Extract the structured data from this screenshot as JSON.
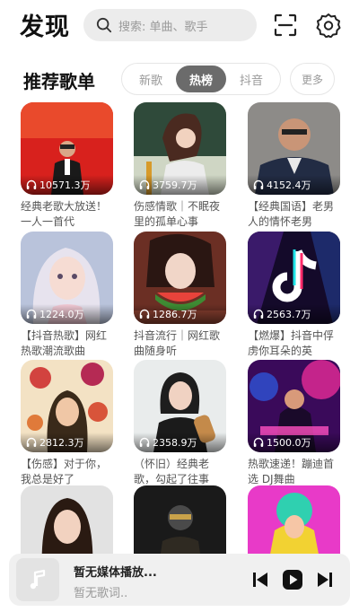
{
  "header": {
    "title": "发现",
    "search_placeholder": "搜索: 单曲、歌手"
  },
  "section": {
    "title": "推荐歌单",
    "tabs": [
      {
        "label": "新歌",
        "active": false
      },
      {
        "label": "热榜",
        "active": true
      },
      {
        "label": "抖音",
        "active": false
      }
    ],
    "more_label": "更多"
  },
  "playlists": [
    {
      "count": "10571.3万",
      "caption": "经典老歌大放送！一人一首代"
    },
    {
      "count": "3759.7万",
      "caption": "伤感情歌｜不眠夜里的孤单心事"
    },
    {
      "count": "4152.4万",
      "caption": "【经典国语】老男人的情怀老男"
    },
    {
      "count": "1224.0万",
      "caption": "【抖音热歌】网红热歌潮流歌曲"
    },
    {
      "count": "1286.7万",
      "caption": "抖音流行｜网红歌曲随身听"
    },
    {
      "count": "2563.7万",
      "caption": "【燃爆】抖音中俘虏你耳朵的英"
    },
    {
      "count": "2812.3万",
      "caption": "【伤感】对于你，我总是好了"
    },
    {
      "count": "2358.9万",
      "caption": "（怀旧）经典老歌，勾起了往事"
    },
    {
      "count": "1500.0万",
      "caption": "热歌速递！蹦迪首选 DJ舞曲"
    },
    {
      "count": "",
      "caption": ""
    },
    {
      "count": "",
      "caption": ""
    },
    {
      "count": "",
      "caption": ""
    }
  ],
  "player": {
    "title": "暂无媒体播放...",
    "lyric": "暂无歌词.."
  }
}
